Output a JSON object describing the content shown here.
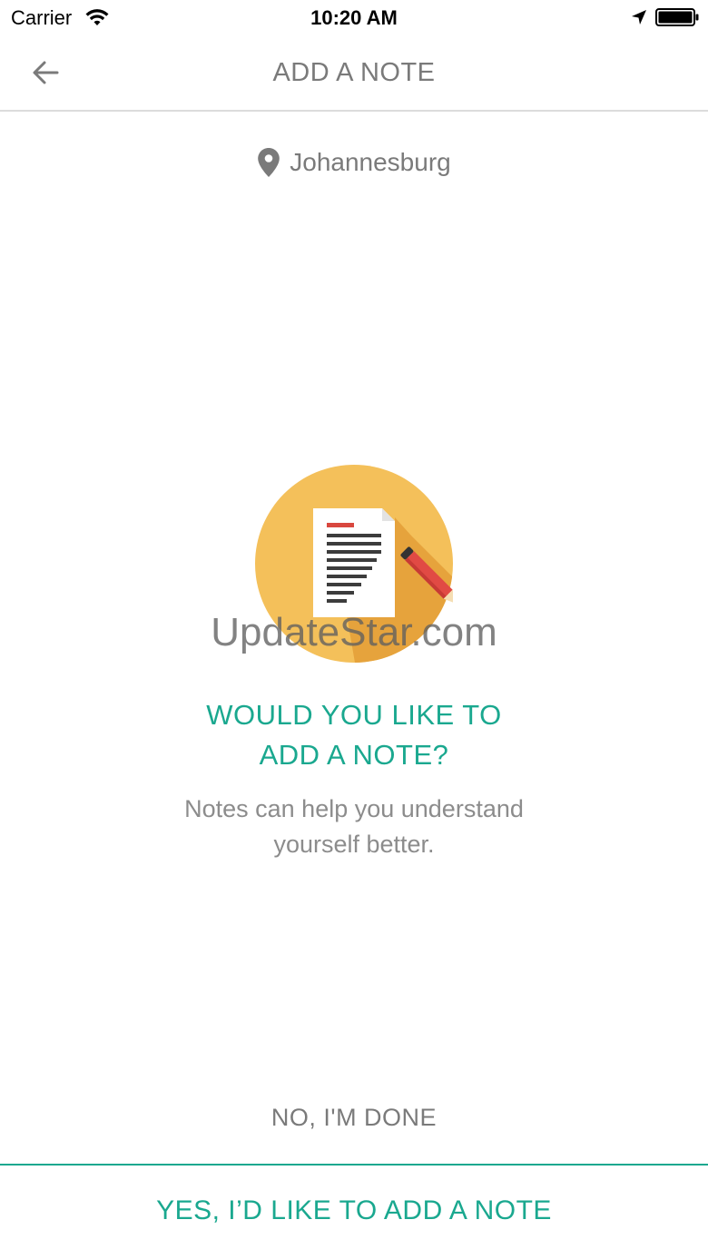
{
  "status_bar": {
    "carrier": "Carrier",
    "time": "10:20 AM",
    "icons": [
      "wifi-icon",
      "location-arrow-icon",
      "battery-icon"
    ]
  },
  "nav": {
    "title": "ADD A NOTE",
    "back_icon": "back-arrow-icon"
  },
  "location": {
    "icon": "map-pin-icon",
    "name": "Johannesburg"
  },
  "illustration": {
    "icon": "note-pencil-icon",
    "watermark": "UpdateStar.com"
  },
  "prompt": {
    "heading_line1": "WOULD YOU LIKE TO",
    "heading_line2": "ADD A NOTE?",
    "sub_line1": "Notes can help you understand",
    "sub_line2": "yourself better."
  },
  "actions": {
    "no_label": "NO, I'M DONE",
    "yes_label": "YES, I’D LIKE TO ADD A NOTE"
  },
  "colors": {
    "accent": "#1aa88f",
    "text_gray": "#7a7a7a",
    "illustration_circle": "#f4c05a",
    "illustration_shadow": "#e6a33c",
    "pencil_red": "#e14a44",
    "accent_line_red": "#d9473f"
  }
}
